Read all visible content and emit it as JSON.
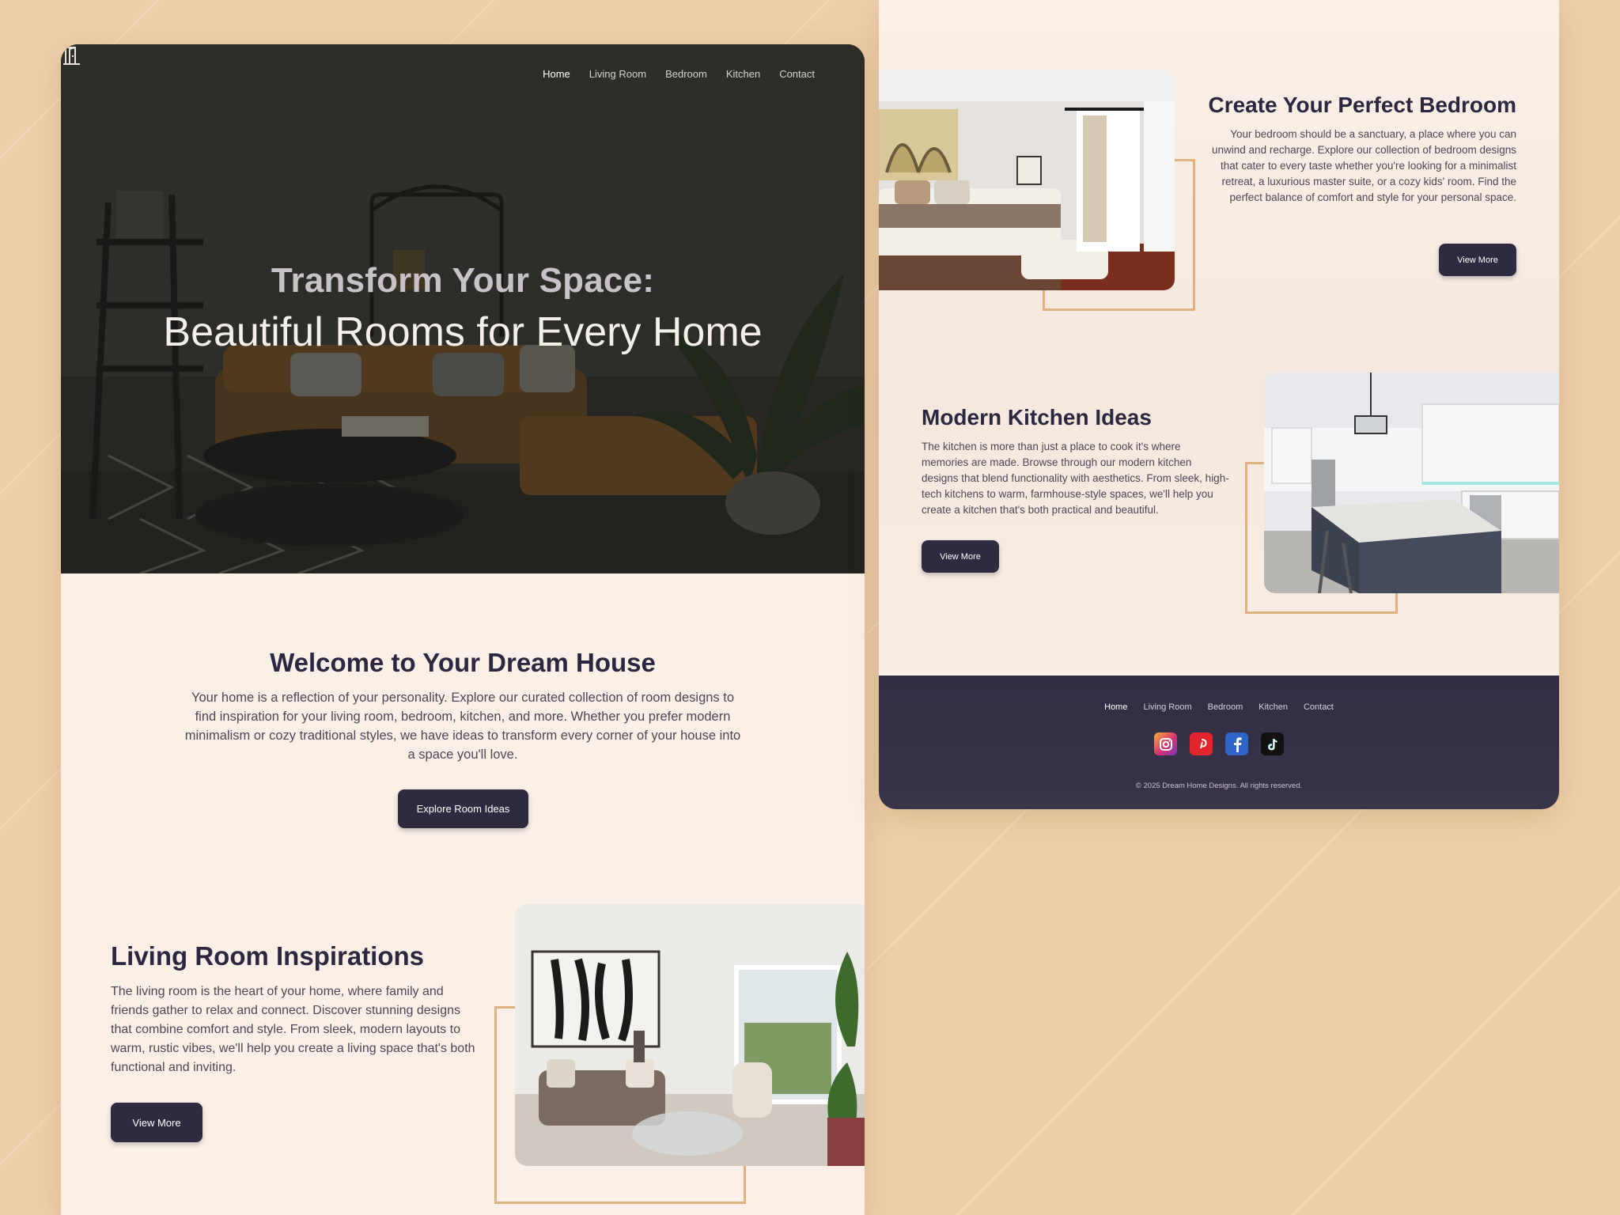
{
  "nav": {
    "items": [
      {
        "label": "Home",
        "active": true
      },
      {
        "label": "Living Room",
        "active": false
      },
      {
        "label": "Bedroom",
        "active": false
      },
      {
        "label": "Kitchen",
        "active": false
      },
      {
        "label": "Contact",
        "active": false
      }
    ]
  },
  "hero": {
    "title_line1": "Transform Your Space:",
    "title_line2": "Beautiful Rooms for Every Home"
  },
  "welcome": {
    "title": "Welcome to Your Dream House",
    "text": "Your home is a reflection of your personality. Explore our curated collection of room designs to find inspiration for your living room, bedroom, kitchen, and more. Whether you prefer modern minimalism or cozy traditional styles, we have ideas to transform every corner of your house into a space you'll love.",
    "button_label": "Explore Room Ideas"
  },
  "living_room": {
    "title": "Living Room Inspirations",
    "text": "The living room is the heart of your home, where family and friends gather to relax and connect. Discover stunning designs that combine comfort and style. From sleek, modern layouts to warm, rustic vibes, we'll help you create a living space that's both functional and inviting.",
    "button_label": "View More"
  },
  "bedroom": {
    "title": "Create Your Perfect Bedroom",
    "text": "Your bedroom should be a sanctuary, a place where you can unwind and recharge. Explore our collection of bedroom designs that cater to every taste whether you're looking for a minimalist retreat, a luxurious master suite, or a cozy kids' room. Find the perfect balance of comfort and style for your personal space.",
    "button_label": "View More"
  },
  "kitchen": {
    "title": "Modern Kitchen Ideas",
    "text": "The kitchen is more than just a place to cook it's where memories are made. Browse through our modern kitchen designs that blend functionality with aesthetics. From sleek, high-tech kitchens to warm, farmhouse-style spaces, we'll help you create a kitchen that's both practical and beautiful.",
    "button_label": "View More"
  },
  "footer": {
    "nav": [
      {
        "label": "Home",
        "active": true
      },
      {
        "label": "Living Room",
        "active": false
      },
      {
        "label": "Bedroom",
        "active": false
      },
      {
        "label": "Kitchen",
        "active": false
      },
      {
        "label": "Contact",
        "active": false
      }
    ],
    "socials": [
      {
        "name": "instagram-icon",
        "color": "#d6306f"
      },
      {
        "name": "pinterest-icon",
        "color": "#e0262c"
      },
      {
        "name": "facebook-icon",
        "color": "#2f64c9"
      },
      {
        "name": "tiktok-icon",
        "color": "#111111"
      }
    ],
    "copyright": "© 2025 Dream Home Designs. All rights reserved."
  },
  "colors": {
    "page_background": "#efcfa9",
    "panel_background": "#faf0e7",
    "primary_dark": "#2f2a40",
    "accent_frame": "#e0b27e"
  }
}
